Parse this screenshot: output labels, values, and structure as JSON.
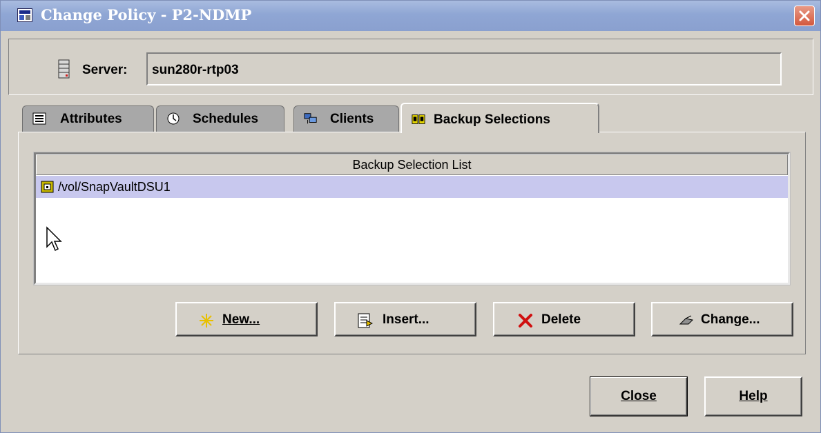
{
  "window": {
    "title": "Change Policy - P2-NDMP"
  },
  "server": {
    "label": "Server:",
    "value": "sun280r-rtp03"
  },
  "tabs": [
    {
      "label": "Attributes",
      "icon": "list-icon"
    },
    {
      "label": "Schedules",
      "icon": "clock-icon"
    },
    {
      "label": "Clients",
      "icon": "computers-icon"
    },
    {
      "label": "Backup Selections",
      "icon": "books-icon",
      "active": true
    }
  ],
  "selection_list": {
    "header": "Backup Selection List",
    "rows": [
      {
        "path": "/vol/SnapVaultDSU1",
        "icon": "volume-icon",
        "selected": true
      }
    ]
  },
  "list_buttons": {
    "new": "New...",
    "insert": "Insert...",
    "delete": "Delete",
    "change": "Change..."
  },
  "dialog_buttons": {
    "close": "Close",
    "help": "Help"
  },
  "colors": {
    "titlebar": "#8fa6d4",
    "close_button": "#d3583e",
    "selected_row": "#c8c8ee",
    "window_bg": "#d4d0c8"
  }
}
